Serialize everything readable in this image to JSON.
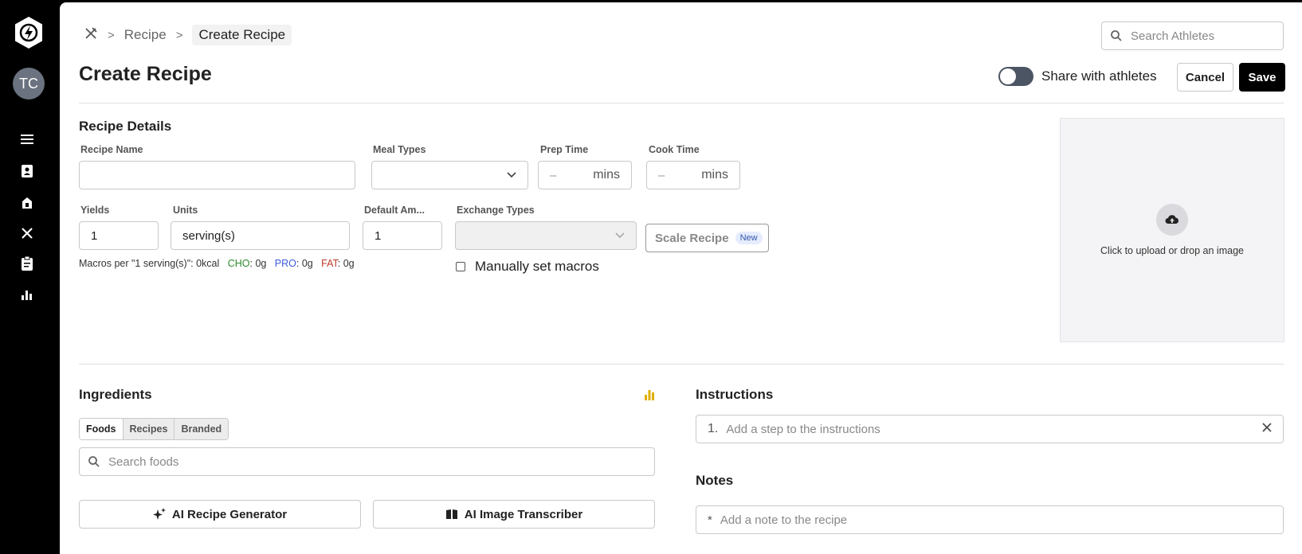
{
  "sidebar": {
    "avatar_initials": "TC",
    "nav_icons": [
      "menu-icon",
      "contacts-icon",
      "calendar-icon",
      "utensils-icon",
      "clipboard-icon",
      "bar-chart-icon"
    ]
  },
  "breadcrumb": {
    "items": [
      "Recipe",
      "Create Recipe"
    ],
    "separator": ">"
  },
  "search_athletes": {
    "placeholder": "Search Athletes"
  },
  "header": {
    "title": "Create Recipe",
    "share_label": "Share with athletes",
    "share_enabled": false,
    "cancel_label": "Cancel",
    "save_label": "Save"
  },
  "details": {
    "section_title": "Recipe Details",
    "recipe_name": {
      "label": "Recipe Name",
      "value": ""
    },
    "meal_types": {
      "label": "Meal Types",
      "value": ""
    },
    "prep_time": {
      "label": "Prep Time",
      "value": "–",
      "unit": "mins"
    },
    "cook_time": {
      "label": "Cook Time",
      "value": "–",
      "unit": "mins"
    },
    "yields": {
      "label": "Yields",
      "value": "1"
    },
    "units": {
      "label": "Units",
      "value": "serving(s)"
    },
    "default_amount": {
      "label": "Default Am...",
      "value": "1"
    },
    "exchange_types": {
      "label": "Exchange Types",
      "value": ""
    },
    "scale_recipe": {
      "label": "Scale Recipe",
      "badge": "New"
    },
    "macros": {
      "prefix": "Macros per \"1 serving(s)\": 0kcal",
      "cho_label": "CHO",
      "cho_value": ": 0g",
      "pro_label": "PRO",
      "pro_value": ": 0g",
      "fat_label": "FAT",
      "fat_value": ": 0g"
    },
    "manual_macros_label": "Manually set macros",
    "upload_text": "Click to upload or drop an image"
  },
  "ingredients": {
    "section_title": "Ingredients",
    "tabs": [
      "Foods",
      "Recipes",
      "Branded"
    ],
    "active_tab": "Foods",
    "search_placeholder": "Search foods",
    "ai_generator_label": "AI Recipe Generator",
    "ai_transcriber_label": "AI Image Transcriber"
  },
  "instructions": {
    "section_title": "Instructions",
    "step_number": "1.",
    "placeholder": "Add a step to the instructions"
  },
  "notes": {
    "section_title": "Notes",
    "bullet": "*",
    "placeholder": "Add a note to the recipe"
  },
  "colors": {
    "cho": "#2e8b2e",
    "pro": "#3b5bdb",
    "fat": "#c0392b",
    "chart_icon": "#e0b000",
    "primary": "#000000"
  }
}
